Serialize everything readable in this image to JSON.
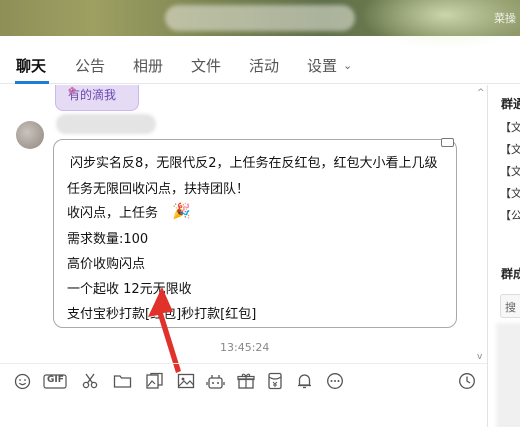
{
  "header": {
    "corner_text": "菜操"
  },
  "tabs": [
    {
      "label": "聊天"
    },
    {
      "label": "公告"
    },
    {
      "label": "相册"
    },
    {
      "label": "文件"
    },
    {
      "label": "活动"
    },
    {
      "label": "设置"
    }
  ],
  "chat": {
    "previous_message": "有的滴我",
    "message_lines": [
      "闪步实名反8，无限代反2，上任务在反红包，红包大小看上几级",
      "任务无限回收闪点，扶持团队！",
      "收闪点，上任务",
      "需求数量:100",
      "高价收购闪点",
      "一个起收  12元无限收",
      "支付宝秒打款[红包]秒打款[红包]"
    ],
    "party_emoji": "🎉",
    "timestamp": "13:45:24"
  },
  "toolbar": {
    "gif_label": "GIF",
    "tools": [
      "emoji",
      "gif",
      "screenshot",
      "folder",
      "image-editor",
      "image",
      "robot",
      "gift",
      "red-packet",
      "bell",
      "more",
      "history"
    ]
  },
  "right_panel": {
    "announcement_title": "群通",
    "announcement_items": [
      "【文",
      "【文",
      "【文",
      "【文",
      "【公"
    ],
    "members_title": "群成",
    "search_label": "搜"
  },
  "colors": {
    "accent": "#1e7bd6",
    "arrow": "#e0312a",
    "bubble_border": "#a9a9a9"
  }
}
